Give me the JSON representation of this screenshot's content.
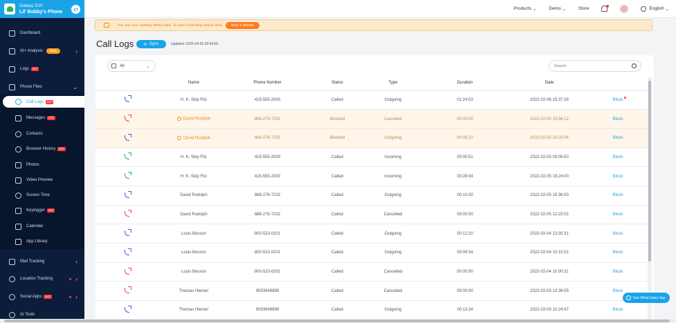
{
  "device": {
    "model": "Galaxy S10",
    "name": "Lil' Bobby's Phone"
  },
  "nav": {
    "dashboard": "Dashboard",
    "ai_analysis": "AI+ Analysis",
    "ai_badge": "New",
    "logs": "Logs",
    "hot_badge": "HOT",
    "phone_files": "Phone Files",
    "call_logs": "Call Logs",
    "messages": "Messages",
    "contacts": "Contacts",
    "browser_history": "Browser History",
    "photos": "Photos",
    "video_preview": "Video Preview",
    "screen_time": "Screen Time",
    "keylogger": "Keylogger",
    "calendar": "Calendar",
    "app_library": "App Library",
    "mail_tracking": "Mail Tracking",
    "location_tracking": "Location Tracking",
    "social_apps": "Social Apps",
    "ai_tools": "AI Tools"
  },
  "topbar": {
    "products": "Products",
    "demo": "Demo",
    "store": "Store",
    "language": "English"
  },
  "banner": {
    "text": "You are now viewing demo data. To start collecting actual data,",
    "button": "bind a device"
  },
  "page": {
    "title": "Call Logs",
    "sync": "Sync",
    "updated": "Updated: 2025-04-03 09:54:59"
  },
  "filter": {
    "selected": "All"
  },
  "search": {
    "placeholder": "Search"
  },
  "columns": [
    "Name",
    "Phone Number",
    "Status",
    "Type",
    "Duration",
    "Date"
  ],
  "rows": [
    {
      "dir": "out",
      "name": "H. K. Skip Fitz",
      "phone": "415-555-2000",
      "status": "Called",
      "type": "Outgoing",
      "duration": "01:24:03",
      "date": "2022-02-06 15:37:28",
      "action": "Block",
      "flag": false,
      "dot": true
    },
    {
      "dir": "can",
      "name": "David Rudolph",
      "phone": "888-276-7202",
      "status": "Blocked",
      "type": "Canceled",
      "duration": "00:00:00",
      "date": "2022-02-05 15:36:12",
      "action": "Block",
      "flag": true,
      "dot": false
    },
    {
      "dir": "out",
      "name": "David Rudolph",
      "phone": "888-276-7202",
      "status": "Blocked",
      "type": "Outgoing",
      "duration": "00:05:10",
      "date": "2022-02-05 15:25:04",
      "action": "Block",
      "flag": true,
      "dot": false
    },
    {
      "dir": "in",
      "name": "H. K. Skip Fitz",
      "phone": "415-555-2000",
      "status": "Called",
      "type": "Incoming",
      "duration": "00:00:51",
      "date": "2022-02-05 09:06:50",
      "action": "Block",
      "flag": false,
      "dot": false
    },
    {
      "dir": "in",
      "name": "H. K. Skip Fitz",
      "phone": "415-555-2000",
      "status": "Called",
      "type": "Incoming",
      "duration": "00:28:04",
      "date": "2022-02-05 19:24:00",
      "action": "Block",
      "flag": false,
      "dot": false
    },
    {
      "dir": "out",
      "name": "David Rudolph",
      "phone": "888-276-7202",
      "status": "Called",
      "type": "Outgoing",
      "duration": "00:10:00",
      "date": "2022-02-05 15:36:00",
      "action": "Block",
      "flag": false,
      "dot": false
    },
    {
      "dir": "can",
      "name": "David Rudolph",
      "phone": "888-276-7202",
      "status": "Called",
      "type": "Cancelled",
      "duration": "00:00:00",
      "date": "2022-02-05 12:23:02",
      "action": "Block",
      "flag": false,
      "dot": false
    },
    {
      "dir": "out",
      "name": "Louis Besson",
      "phone": "800-523-0201",
      "status": "Called",
      "type": "Outgoing",
      "duration": "00:12:20",
      "date": "2022-02-04 13:35:31",
      "action": "Block",
      "flag": false,
      "dot": false
    },
    {
      "dir": "out",
      "name": "Louis Besson",
      "phone": "800-523-0201",
      "status": "Called",
      "type": "Outgoing",
      "duration": "00:09:54",
      "date": "2022-02-04 10:15:01",
      "action": "Block",
      "flag": false,
      "dot": false
    },
    {
      "dir": "can",
      "name": "Louis Besson",
      "phone": "800-523-0201",
      "status": "Called",
      "type": "Cancelled",
      "duration": "00:00:00",
      "date": "2022-02-04 10:00:31",
      "action": "Block",
      "flag": false,
      "dot": false
    },
    {
      "dir": "can",
      "name": "Thomas Hiemer",
      "phone": "9093949899",
      "status": "Called",
      "type": "Cancelled",
      "duration": "00:00:00",
      "date": "2022-02-03 13:36:05",
      "action": "Block",
      "flag": false,
      "dot": false
    },
    {
      "dir": "out",
      "name": "Thomas Hiemer",
      "phone": "9093949899",
      "status": "Called",
      "type": "Outgoing",
      "duration": "00:13:34",
      "date": "2022-02-03 10:24:47",
      "action": "Block",
      "flag": false,
      "dot": false
    }
  ],
  "floating": {
    "label": "See What Users Say"
  },
  "colors": {
    "accent": "#1ba3e8",
    "sidebar": "#0b1d3a",
    "warning": "#f08a12"
  }
}
